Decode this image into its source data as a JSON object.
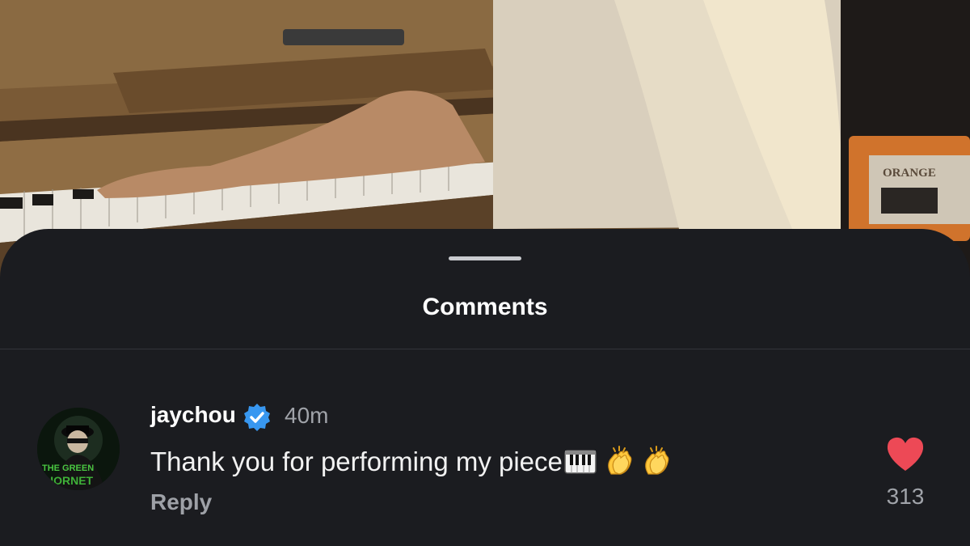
{
  "sheet": {
    "title": "Comments"
  },
  "comment": {
    "username": "jaychou",
    "verified": true,
    "timestamp": "40m",
    "text": "Thank you for performing my piece",
    "trailing_icons": [
      "piano-icon",
      "clap-icon",
      "clap-icon"
    ],
    "reply_label": "Reply",
    "like_count": "313",
    "liked": true,
    "avatar_text": "THE GREEN HORNET"
  },
  "video_frame": {
    "amp_label": "ORANGE"
  },
  "colors": {
    "sheet_bg": "#1b1c20",
    "verified_blue": "#3897f0",
    "heart_red": "#ed4956",
    "muted_text": "#a0a3a9"
  }
}
